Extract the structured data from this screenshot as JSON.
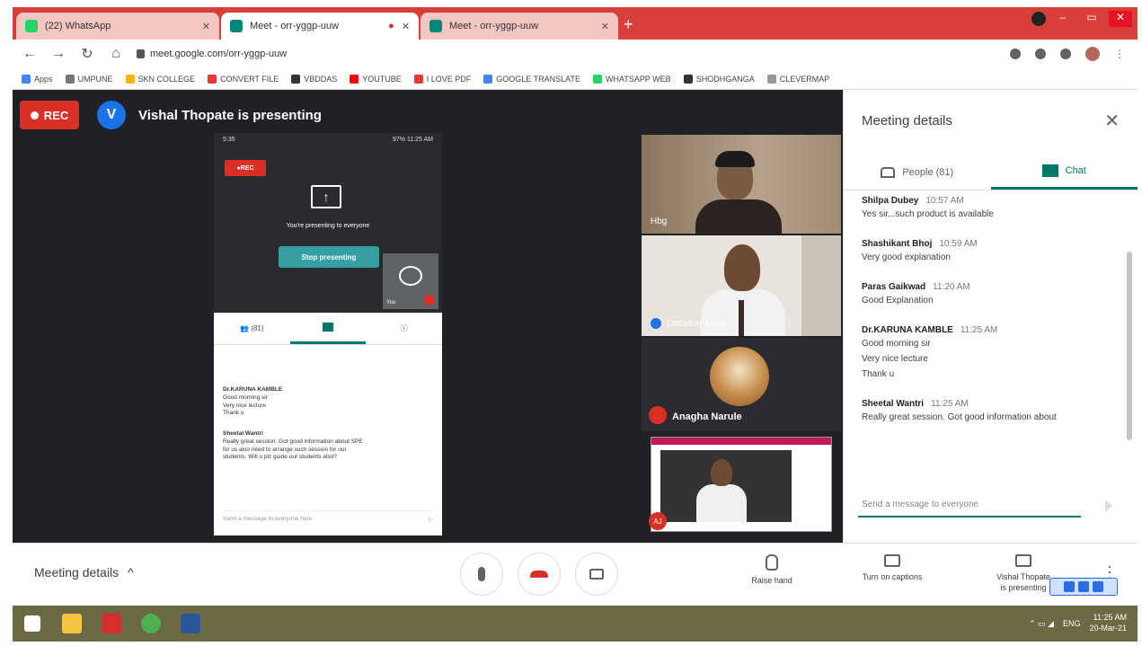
{
  "browser": {
    "tabs": [
      {
        "label": "(22) WhatsApp",
        "color": "#25d366"
      },
      {
        "label": "Meet - orr-yggp-uuw",
        "color": "#00897b"
      },
      {
        "label": "Meet - orr-yggp-uuw",
        "color": "#00897b"
      }
    ],
    "url": "meet.google.com/orr-yggp-uuw",
    "bookmarks": [
      {
        "label": "Apps",
        "color": "#4285f4"
      },
      {
        "label": "UMPUNE",
        "color": "#777777"
      },
      {
        "label": "SKN COLLEGE",
        "color": "#f4b400"
      },
      {
        "label": "CONVERT FILE",
        "color": "#e53935"
      },
      {
        "label": "VBDDAS",
        "color": "#333333"
      },
      {
        "label": "YOUTUBE",
        "color": "#ff0000"
      },
      {
        "label": "I LOVE PDF",
        "color": "#e53935"
      },
      {
        "label": "GOOGLE TRANSLATE",
        "color": "#4285f4"
      },
      {
        "label": "WHATSAPP WEB",
        "color": "#25d366"
      },
      {
        "label": "SHODHGANGA",
        "color": "#333333"
      },
      {
        "label": "CLEVERMAP",
        "color": "#999999"
      }
    ]
  },
  "meet": {
    "rec_label": "REC",
    "presenter_initial": "V",
    "presenter_text": "Vishal Thopate is presenting",
    "phone": {
      "status_left": "5:35",
      "status_right": "97% 11:25 AM",
      "rec_label": "REC",
      "presenting_text": "You're presenting to everyone",
      "stop_label": "Stop presenting",
      "you_label": "You",
      "people_tab": "(81)",
      "messages": [
        {
          "name": "Dr.KARUNA KAMBLE",
          "lines": [
            "Good morning sir",
            "Very nice lecture",
            "Thank u"
          ]
        },
        {
          "name": "Sheetal Wantri",
          "lines": [
            "Really great session. Got good information about SPE",
            "for us also need to arrange such session for our",
            "students. Will u plz guide our students also?"
          ]
        }
      ],
      "input_placeholder": "Send a message to everyone here"
    },
    "participants": [
      {
        "name": "Hbg"
      },
      {
        "name": "Dattatray More"
      },
      {
        "name": "Anagha Narule"
      },
      {
        "name": "AJ"
      }
    ]
  },
  "panel": {
    "title": "Meeting details",
    "people_tab": "People (81)",
    "chat_tab": "Chat",
    "messages": [
      {
        "name": "Shilpa Dubey",
        "time": "10:57 AM",
        "lines": [
          "Yes sir...such product is available"
        ]
      },
      {
        "name": "Shashikant Bhoj",
        "time": "10:59 AM",
        "lines": [
          "Very good explanation"
        ]
      },
      {
        "name": "Paras Gaikwad",
        "time": "11:20 AM",
        "lines": [
          "Good Explanation"
        ]
      },
      {
        "name": "Dr.KARUNA KAMBLE",
        "time": "11:25 AM",
        "lines": [
          "Good morning sir",
          "Very nice lecture",
          "Thank u"
        ]
      },
      {
        "name": "Sheetal Wantri",
        "time": "11:25 AM",
        "lines": [
          "Really great session. Got good information about"
        ]
      }
    ],
    "input_placeholder": "Send a message to everyone"
  },
  "bottom": {
    "meeting_details": "Meeting details",
    "raise_hand": "Raise hand",
    "captions": "Turn on captions",
    "presenting_line1": "Vishal Thopate",
    "presenting_line2": "is presenting"
  },
  "taskbar": {
    "lang": "ENG",
    "time": "11:25 AM",
    "date": "20-Mar-21"
  }
}
